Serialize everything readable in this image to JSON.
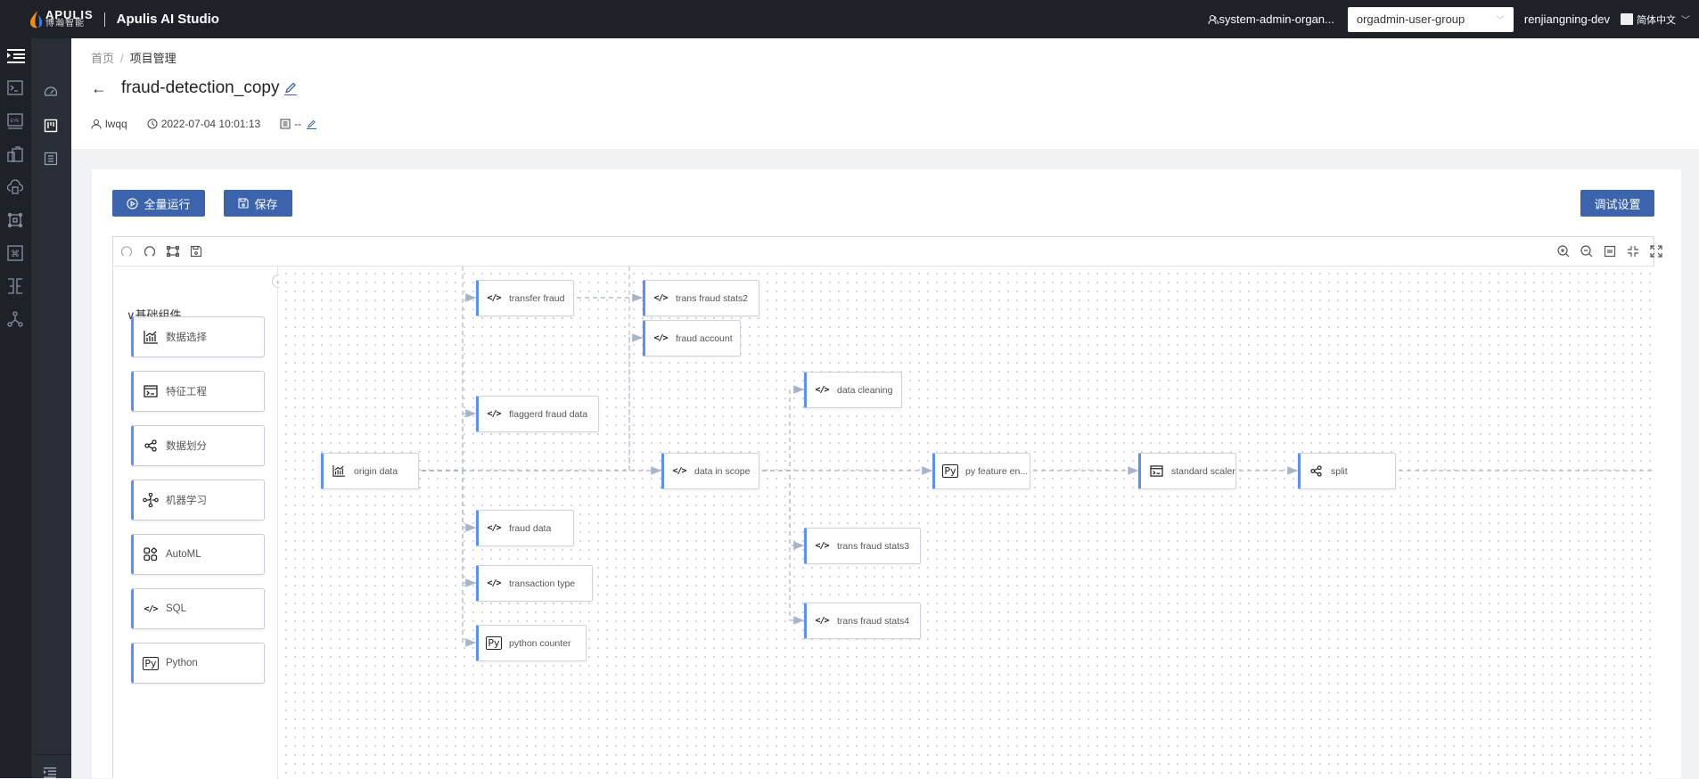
{
  "topbar": {
    "logo_en": "APULIS",
    "logo_cn": "博瀚智能",
    "app_title": "Apulis AI Studio",
    "organization": "system-admin-organ...",
    "user_group": "orgadmin-user-group",
    "username": "renjiangning-dev",
    "language": "简体中文"
  },
  "rail_icons": [
    "menu-toggle-icon",
    "terminal-icon",
    "eye-monitor-icon",
    "dataset-icon",
    "cloud-storage-icon",
    "model-icon",
    "command-icon",
    "workflow-icon",
    "graph-icon"
  ],
  "rail2_icons": [
    "dashboard-icon",
    "kanban-icon",
    "list-icon"
  ],
  "breadcrumb": {
    "home": "首页",
    "separator": "/",
    "current": "项目管理"
  },
  "project": {
    "title": "fraud-detection_copy",
    "owner": "lwqq",
    "created": "2022-07-04 10:01:13",
    "description": "--"
  },
  "actions": {
    "run_all": "全量运行",
    "save": "保存",
    "debug_settings": "调试设置"
  },
  "canvas_toolbar": {
    "left": [
      "undo-icon",
      "redo-icon",
      "fit-frame-icon",
      "save-snapshot-icon"
    ],
    "right": [
      "zoom-in-icon",
      "zoom-out-icon",
      "actual-size-icon",
      "shrink-icon",
      "fullscreen-icon"
    ]
  },
  "component_panel": {
    "group_title": "基础组件",
    "items": [
      {
        "label": "数据选择",
        "icon": "chart-data-icon"
      },
      {
        "label": "特征工程",
        "icon": "terminal-box-icon"
      },
      {
        "label": "数据划分",
        "icon": "share-split-icon"
      },
      {
        "label": "机器学习",
        "icon": "ml-graph-icon"
      },
      {
        "label": "AutoML",
        "icon": "automl-icon"
      },
      {
        "label": "SQL",
        "icon": "code-icon"
      },
      {
        "label": "Python",
        "icon": "python-icon"
      }
    ]
  },
  "graph": {
    "nodes": [
      {
        "id": "origin",
        "label": "origin data",
        "icon": "chart"
      },
      {
        "id": "transfer",
        "label": "transfer fraud",
        "icon": "code"
      },
      {
        "id": "stats2",
        "label": "trans fraud stats2",
        "icon": "code"
      },
      {
        "id": "account",
        "label": "fraud account",
        "icon": "code"
      },
      {
        "id": "flagged",
        "label": "flaggerd fraud data",
        "icon": "code"
      },
      {
        "id": "scope",
        "label": "data in scope",
        "icon": "code"
      },
      {
        "id": "cleaning",
        "label": "data cleaning",
        "icon": "code"
      },
      {
        "id": "pyfeat",
        "label": "py feature en...",
        "icon": "py"
      },
      {
        "id": "scaler",
        "label": "standard scaler",
        "icon": "terminal"
      },
      {
        "id": "split",
        "label": "split",
        "icon": "share"
      },
      {
        "id": "fraud",
        "label": "fraud data",
        "icon": "code"
      },
      {
        "id": "ttype",
        "label": "transaction type",
        "icon": "code"
      },
      {
        "id": "pycounter",
        "label": "python counter",
        "icon": "py"
      },
      {
        "id": "stats3",
        "label": "trans fraud stats3",
        "icon": "code"
      },
      {
        "id": "stats4",
        "label": "trans fraud stats4",
        "icon": "code"
      }
    ],
    "edges": [
      [
        "origin",
        "transfer"
      ],
      [
        "origin",
        "flagged"
      ],
      [
        "origin",
        "fraud"
      ],
      [
        "origin",
        "ttype"
      ],
      [
        "origin",
        "pycounter"
      ],
      [
        "origin",
        "scope"
      ],
      [
        "transfer",
        "stats2"
      ],
      [
        "origin",
        "account"
      ],
      [
        "scope",
        "cleaning"
      ],
      [
        "scope",
        "pyfeat"
      ],
      [
        "scope",
        "stats3"
      ],
      [
        "scope",
        "stats4"
      ],
      [
        "pyfeat",
        "scaler"
      ],
      [
        "scaler",
        "split"
      ]
    ]
  }
}
